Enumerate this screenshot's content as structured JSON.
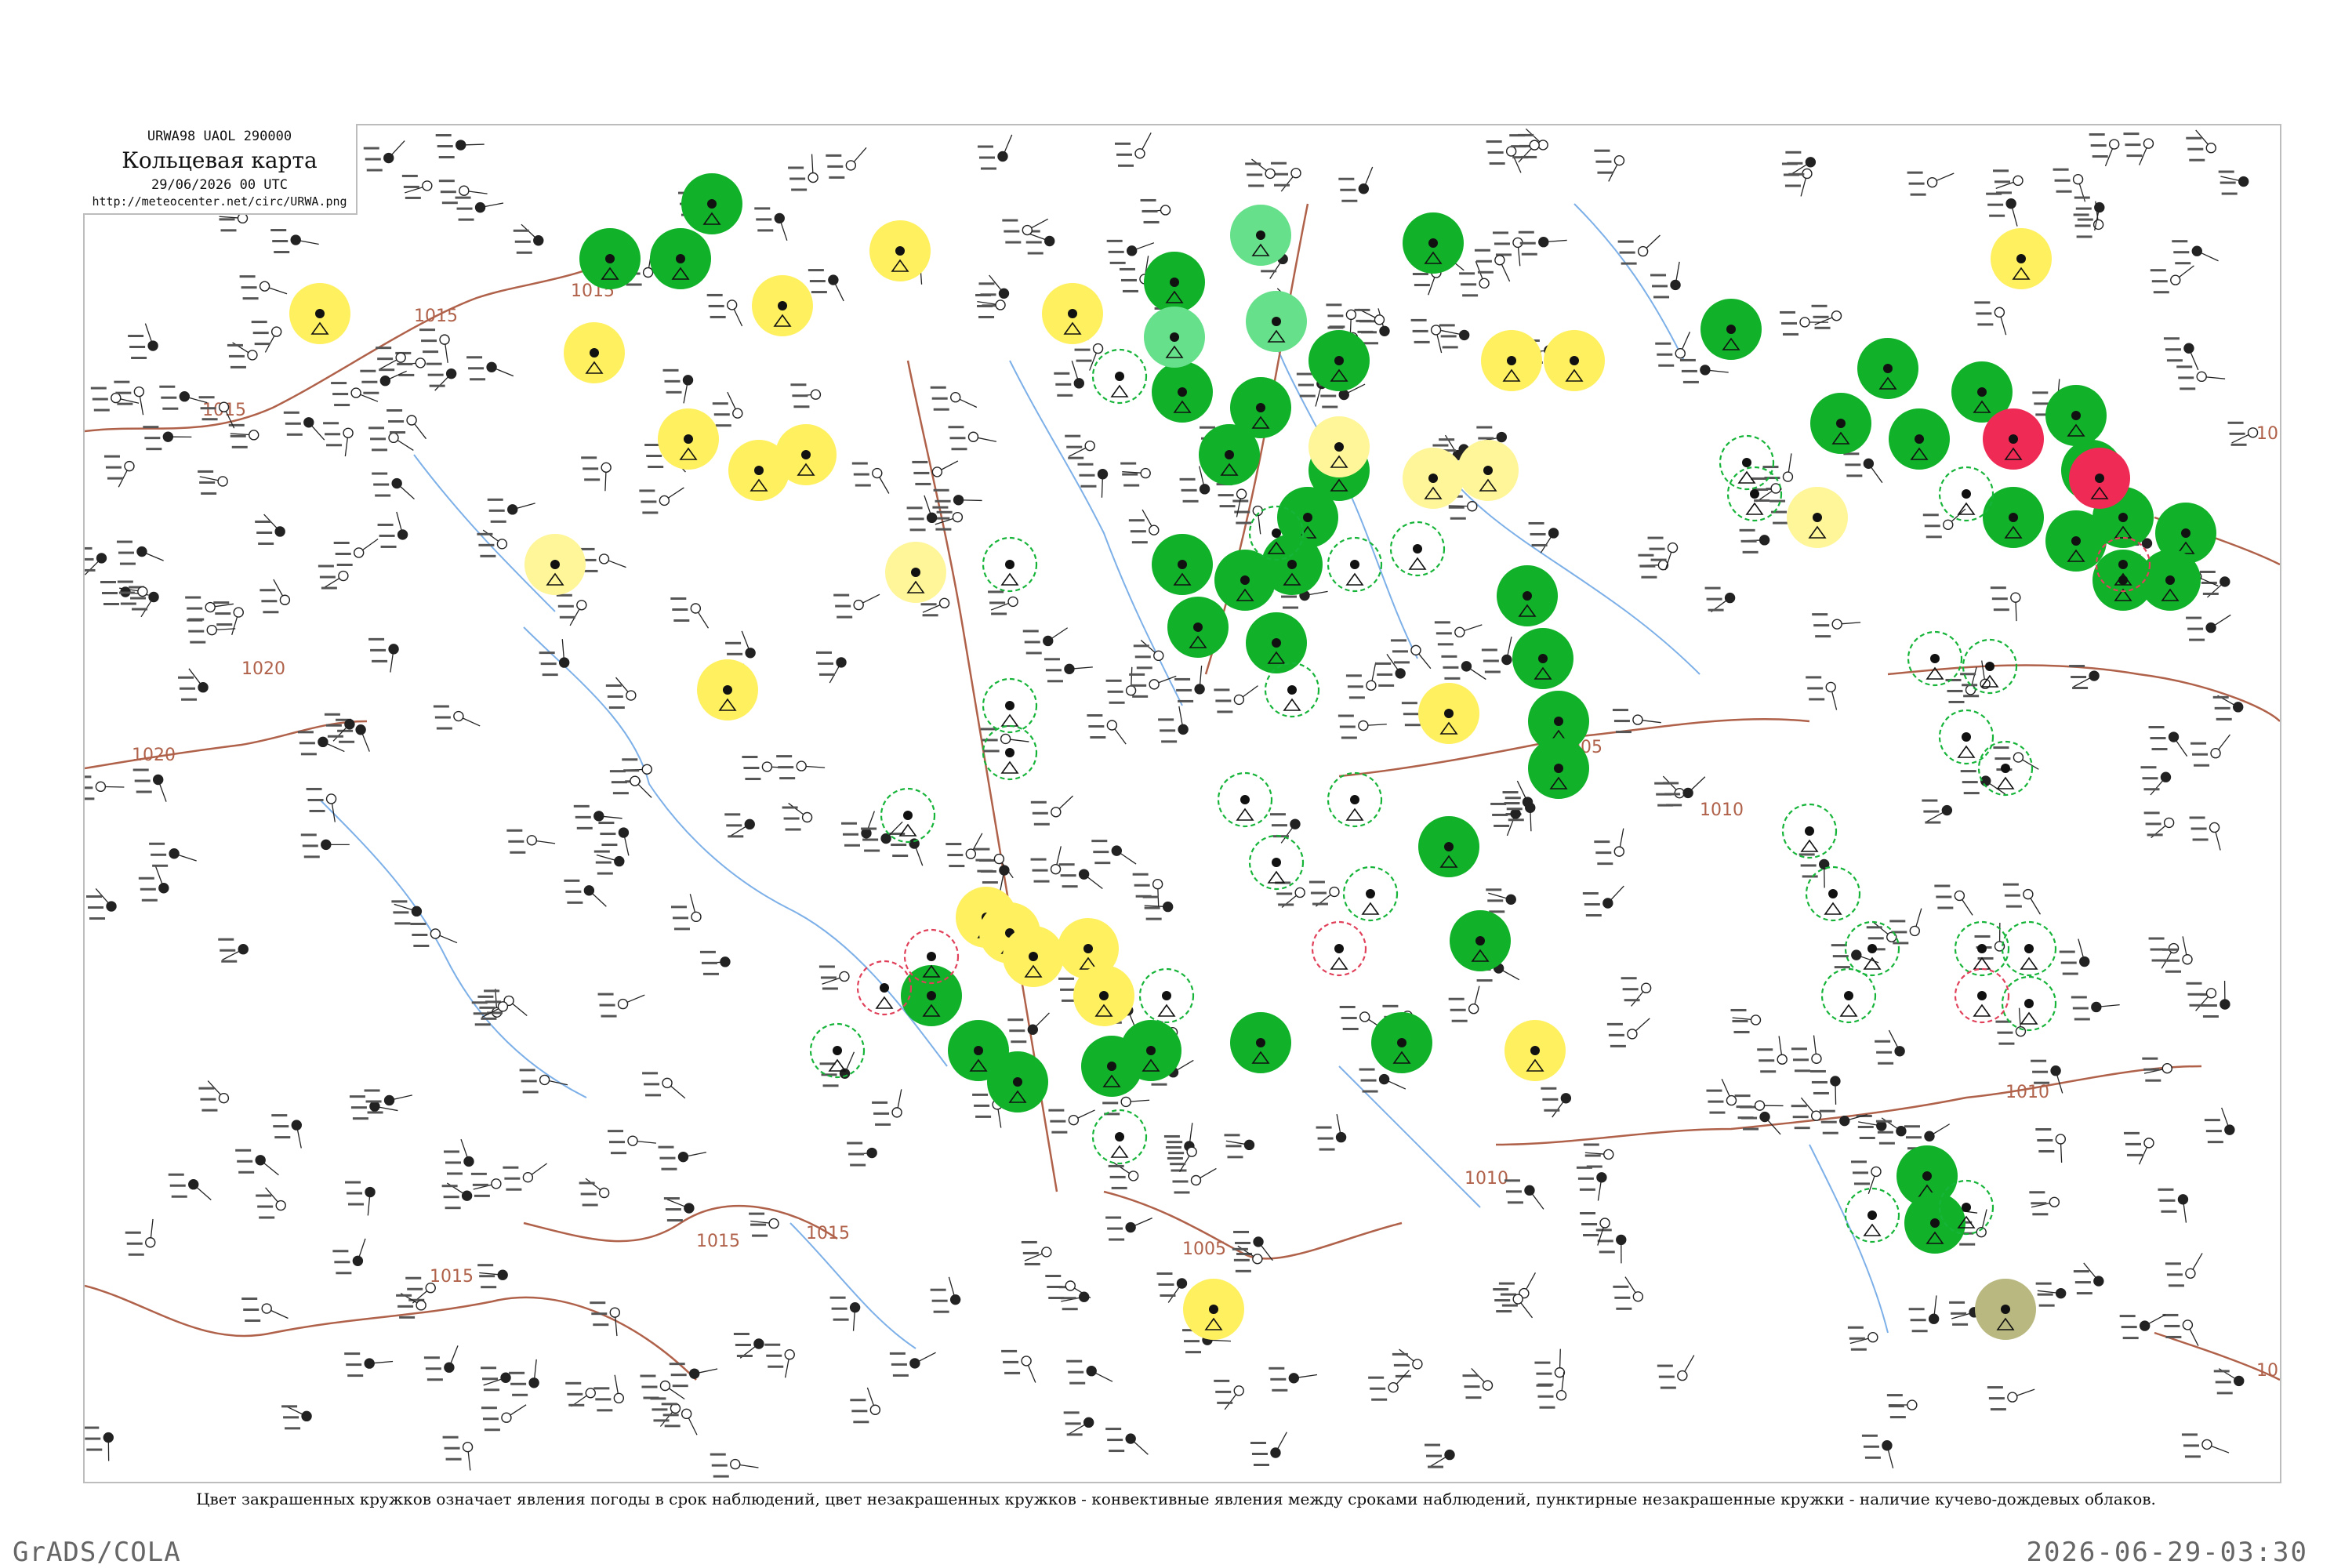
{
  "header": {
    "code": "URWA98  UAOL  290000",
    "title": "Кольцевая карта",
    "date": "29/06/2026 00 UTC",
    "url": "http://meteocenter.net/circ/URWA.png"
  },
  "caption": "Цвет закрашенных кружков означает явления погоды в срок наблюдений, цвет незакрашенных кружков - конвективные явления между сроками наблюдений, пунктирные незакрашенные кружки - наличие кучево-дождевых облаков.",
  "footer": {
    "left": "GrADS/COLA",
    "right": "2026-06-29-03:30"
  },
  "colors": {
    "thunderstorm_green": "#11b22a",
    "light_green": "#66e08a",
    "rain_yellow": "#fff060",
    "pale_yellow": "#fff69a",
    "heavy_red": "#ee2a55",
    "haze_olive": "#b8b880",
    "isobar": "#b0614a",
    "river": "#7db0e8",
    "convective_ring_green": "#17b43a",
    "convective_ring_red": "#e0405a"
  },
  "isobars": [
    "1015",
    "1015",
    "1015",
    "1020",
    "1020",
    "1015",
    "1015",
    "1015",
    "1005",
    "1005",
    "1010",
    "1010",
    "1010",
    "1015",
    "10",
    "10"
  ],
  "legend_icons": [
    "thunderstorm-icon",
    "rain-icon",
    "shower-icon",
    "wind-barb-icon"
  ]
}
